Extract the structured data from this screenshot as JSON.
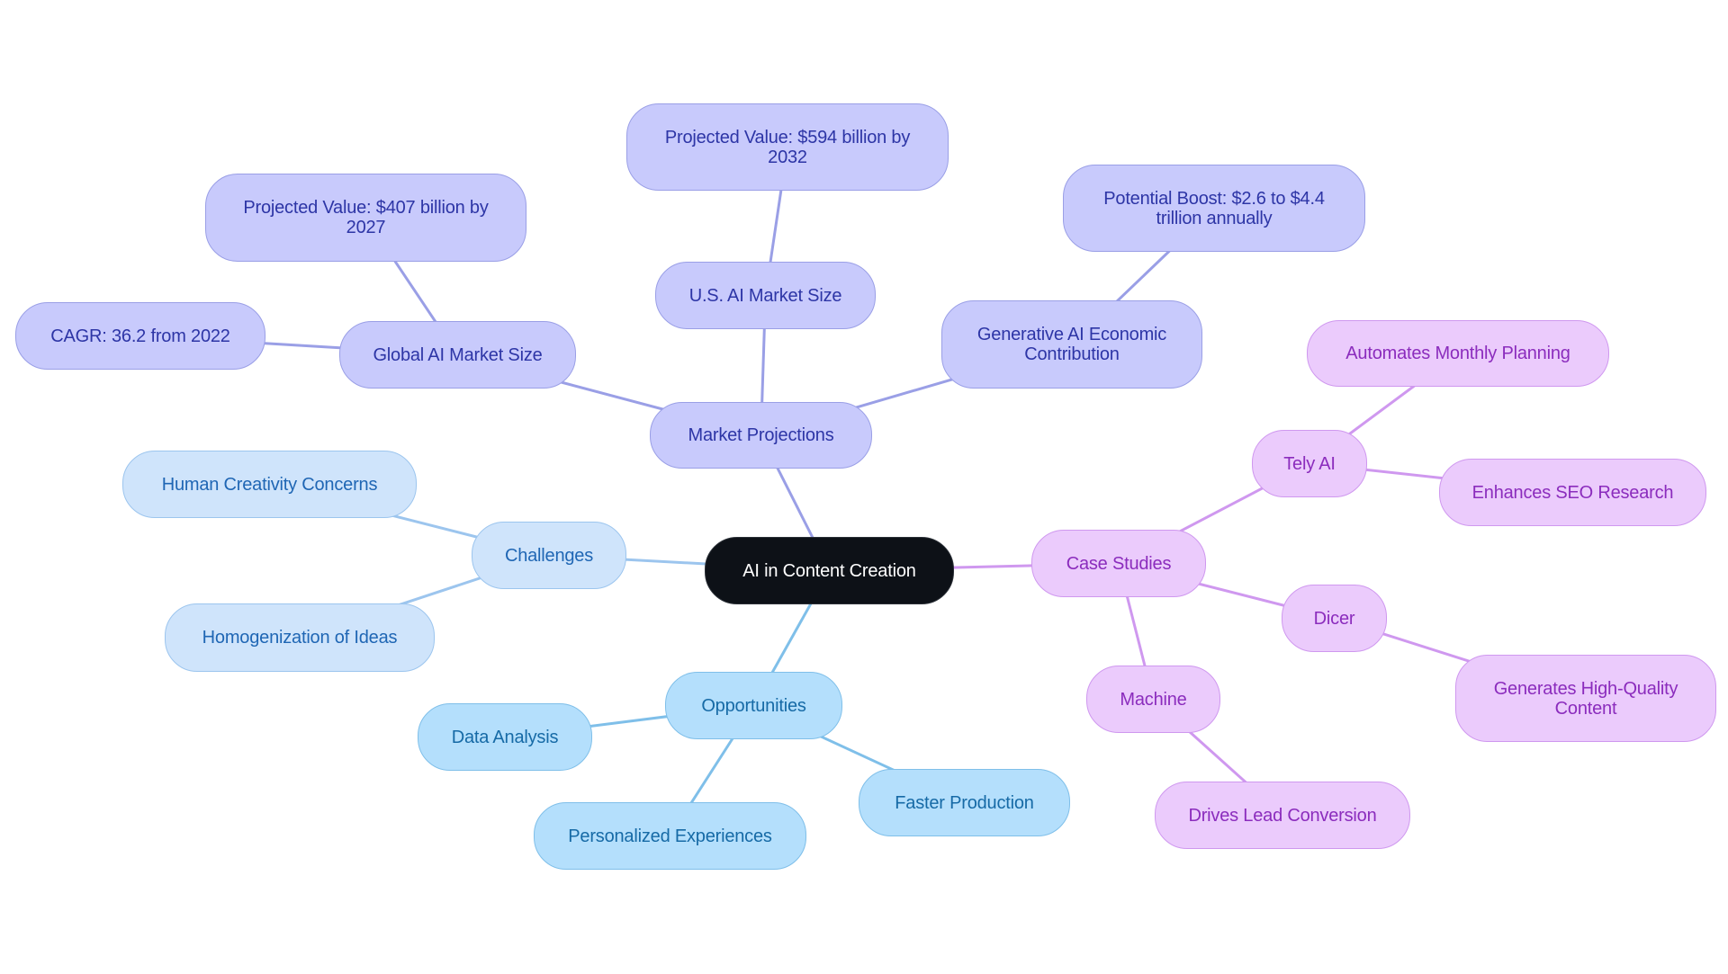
{
  "title": "AI in Content Creation",
  "colors": {
    "root": "#0d1117",
    "market_edge": "#9a9fe6",
    "challenge_edge": "#9cc5ee",
    "opportunity_edge": "#7fbfe9",
    "case_edge": "#cf98ef"
  },
  "nodes": {
    "root": "AI in Content Creation",
    "market_projections": "Market Projections",
    "global_ai_market_size": "Global AI Market Size",
    "cagr": "CAGR: 36.2 from 2022",
    "projected_407": "Projected Value: $407 billion by 2027",
    "us_ai_market_size": "U.S. AI Market Size",
    "projected_594": "Projected Value: $594 billion by 2032",
    "generative_ai": "Generative AI Economic Contribution",
    "potential_boost": "Potential Boost: $2.6 to $4.4 trillion annually",
    "challenges": "Challenges",
    "human_creativity": "Human Creativity Concerns",
    "homogenization": "Homogenization of Ideas",
    "opportunities": "Opportunities",
    "data_analysis": "Data Analysis",
    "personalized": "Personalized Experiences",
    "faster_production": "Faster Production",
    "case_studies": "Case Studies",
    "tely_ai": "Tely AI",
    "automates_planning": "Automates Monthly Planning",
    "enhances_seo": "Enhances SEO Research",
    "dicer": "Dicer",
    "generates_content": "Generates High-Quality Content",
    "machine": "Machine",
    "drives_lead": "Drives Lead Conversion"
  },
  "edges": [
    [
      "root",
      "market_projections",
      "market_edge"
    ],
    [
      "market_projections",
      "global_ai_market_size",
      "market_edge"
    ],
    [
      "global_ai_market_size",
      "cagr",
      "market_edge"
    ],
    [
      "global_ai_market_size",
      "projected_407",
      "market_edge"
    ],
    [
      "market_projections",
      "us_ai_market_size",
      "market_edge"
    ],
    [
      "us_ai_market_size",
      "projected_594",
      "market_edge"
    ],
    [
      "market_projections",
      "generative_ai",
      "market_edge"
    ],
    [
      "generative_ai",
      "potential_boost",
      "market_edge"
    ],
    [
      "root",
      "challenges",
      "challenge_edge"
    ],
    [
      "challenges",
      "human_creativity",
      "challenge_edge"
    ],
    [
      "challenges",
      "homogenization",
      "challenge_edge"
    ],
    [
      "root",
      "opportunities",
      "opportunity_edge"
    ],
    [
      "opportunities",
      "data_analysis",
      "opportunity_edge"
    ],
    [
      "opportunities",
      "personalized",
      "opportunity_edge"
    ],
    [
      "opportunities",
      "faster_production",
      "opportunity_edge"
    ],
    [
      "root",
      "case_studies",
      "case_edge"
    ],
    [
      "case_studies",
      "tely_ai",
      "case_edge"
    ],
    [
      "tely_ai",
      "automates_planning",
      "case_edge"
    ],
    [
      "tely_ai",
      "enhances_seo",
      "case_edge"
    ],
    [
      "case_studies",
      "dicer",
      "case_edge"
    ],
    [
      "dicer",
      "generates_content",
      "case_edge"
    ],
    [
      "case_studies",
      "machine",
      "case_edge"
    ],
    [
      "machine",
      "drives_lead",
      "case_edge"
    ]
  ]
}
